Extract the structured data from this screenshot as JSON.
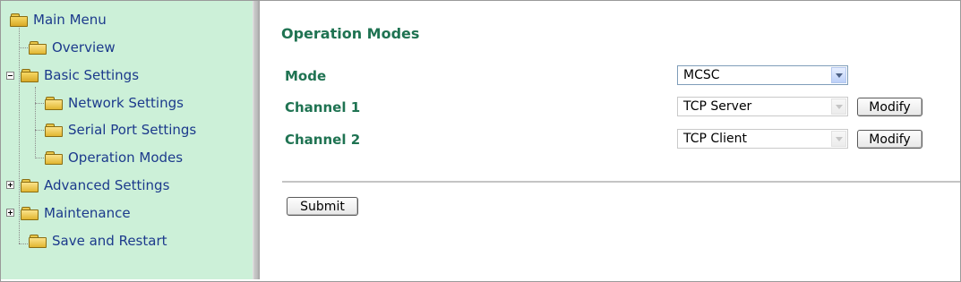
{
  "sidebar": {
    "items": [
      {
        "label": "Main Menu"
      },
      {
        "label": "Overview"
      },
      {
        "label": "Basic Settings"
      },
      {
        "label": "Network Settings"
      },
      {
        "label": "Serial Port Settings"
      },
      {
        "label": "Operation Modes"
      },
      {
        "label": "Advanced Settings"
      },
      {
        "label": "Maintenance"
      },
      {
        "label": "Save and Restart"
      }
    ]
  },
  "main": {
    "title": "Operation Modes",
    "mode": {
      "label": "Mode",
      "value": "MCSC"
    },
    "channels": [
      {
        "label": "Channel 1",
        "value": "TCP Server",
        "modify_label": "Modify"
      },
      {
        "label": "Channel 2",
        "value": "TCP Client",
        "modify_label": "Modify"
      }
    ],
    "submit_label": "Submit"
  }
}
